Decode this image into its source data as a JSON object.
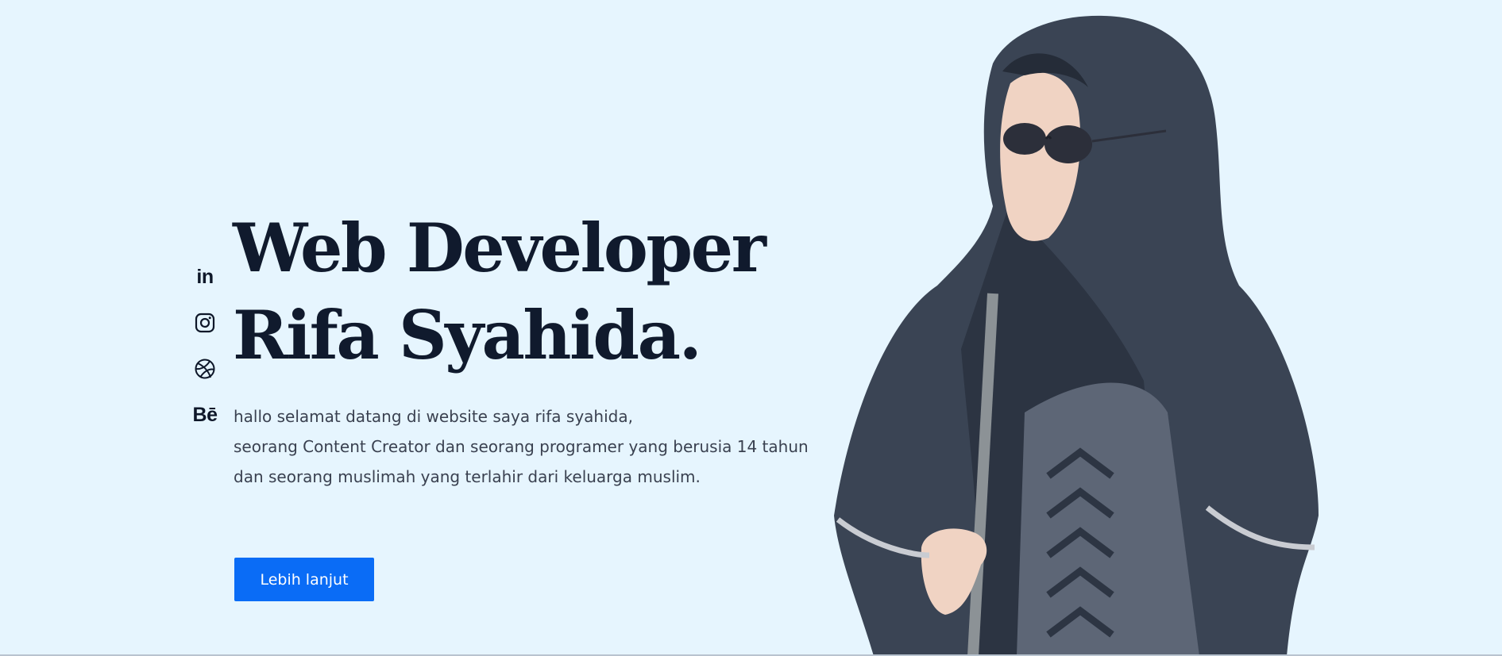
{
  "social": {
    "items": [
      {
        "name": "linkedin",
        "label": "in"
      },
      {
        "name": "instagram"
      },
      {
        "name": "dribbble"
      },
      {
        "name": "behance",
        "label": "Bē"
      }
    ]
  },
  "hero": {
    "title_line1": "Web Developer",
    "title_line2": "Rifa Syahida.",
    "intro_lines": [
      "hallo selamat datang di website saya rifa syahida,",
      "seorang Content Creator dan seorang programer yang berusia 14 tahun",
      "dan seorang muslimah yang terlahir dari keluarga muslim."
    ],
    "cta_label": "Lebih lanjut"
  },
  "colors": {
    "background": "#e6f5fe",
    "heading": "#101a2d",
    "body_text": "#3a4150",
    "accent": "#0a6cf6"
  }
}
